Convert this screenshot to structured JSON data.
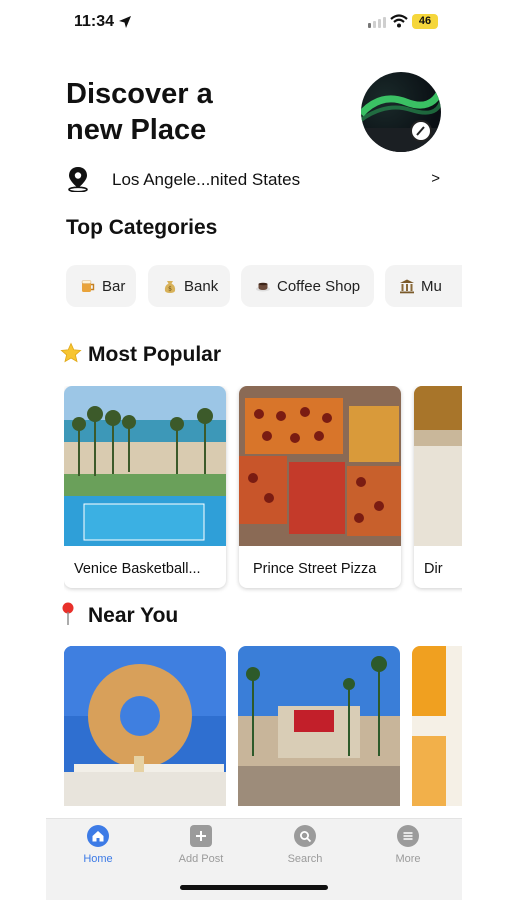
{
  "status_bar": {
    "time": "11:34",
    "battery": "46"
  },
  "header": {
    "title_line1": "Discover a",
    "title_line2": "new Place"
  },
  "location": {
    "text": "Los Angele...nited States",
    "chevron": ">"
  },
  "categories": {
    "title": "Top Categories",
    "items": [
      {
        "label": "Bar",
        "icon": "beer-mug-icon"
      },
      {
        "label": "Bank",
        "icon": "money-bag-icon"
      },
      {
        "label": "Coffee Shop",
        "icon": "coffee-cup-icon"
      },
      {
        "label": "Mu",
        "icon": "museum-icon"
      }
    ]
  },
  "most_popular": {
    "title": "Most Popular",
    "items": [
      {
        "caption": "Venice Basketball..."
      },
      {
        "caption": "Prince Street Pizza"
      },
      {
        "caption": "Dir"
      }
    ]
  },
  "near_you": {
    "title": "Near You",
    "items": [
      {
        "image": "randys-donuts"
      },
      {
        "image": "amc-theater"
      },
      {
        "image": "food"
      }
    ]
  },
  "tabbar": {
    "items": [
      {
        "label": "Home",
        "icon": "home-icon",
        "active": true
      },
      {
        "label": "Add Post",
        "icon": "plus-icon",
        "active": false
      },
      {
        "label": "Search",
        "icon": "search-icon",
        "active": false
      },
      {
        "label": "More",
        "icon": "menu-icon",
        "active": false
      }
    ]
  },
  "colors": {
    "accent": "#3d7be6",
    "chip_bg": "#f3f3f3",
    "tab_inactive": "#9b9b9b",
    "battery": "#f5d63b"
  }
}
